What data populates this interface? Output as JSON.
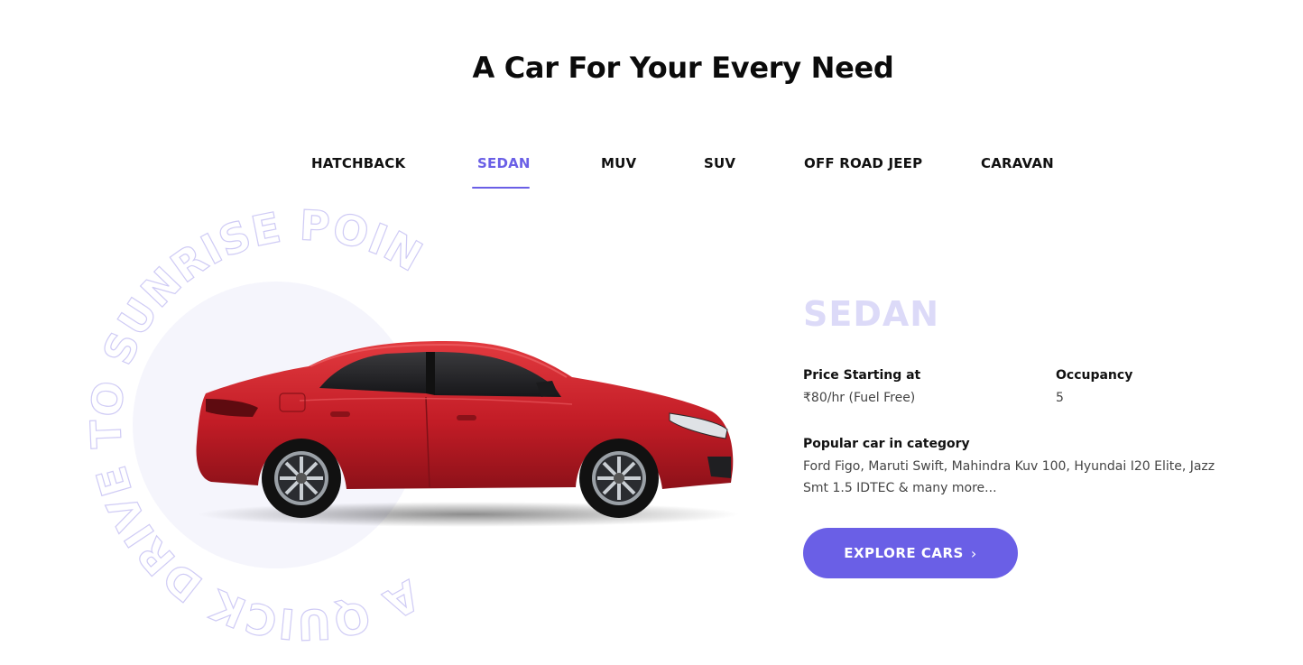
{
  "section": {
    "heading": "A Car For Your Every Need"
  },
  "tabs": [
    {
      "label": "HATCHBACK"
    },
    {
      "label": "SEDAN"
    },
    {
      "label": "MUV"
    },
    {
      "label": "SUV"
    },
    {
      "label": "OFF ROAD JEEP"
    },
    {
      "label": "CARAVAN"
    }
  ],
  "active_tab": "SEDAN",
  "circular_text": "A QUICK DRIVE TO SUNRISE POINT",
  "details": {
    "category": "SEDAN",
    "price_label": "Price Starting at",
    "price_value": "₹80/hr (Fuel Free)",
    "occupancy_label": "Occupancy",
    "occupancy_value": "5",
    "popular_label": "Popular car in category",
    "popular_value": "Ford Figo, Maruti Swift, Mahindra Kuv 100, Hyundai I20 Elite, Jazz Smt 1.5 IDTEC & many more..."
  },
  "cta": {
    "label": "EXPLORE CARS",
    "icon": "chevron-right-icon"
  },
  "colors": {
    "accent": "#6a5fe6",
    "category_title": "#dcdaf8",
    "circle_bg": "#f5f5fc",
    "car_body": "#c8202a"
  }
}
